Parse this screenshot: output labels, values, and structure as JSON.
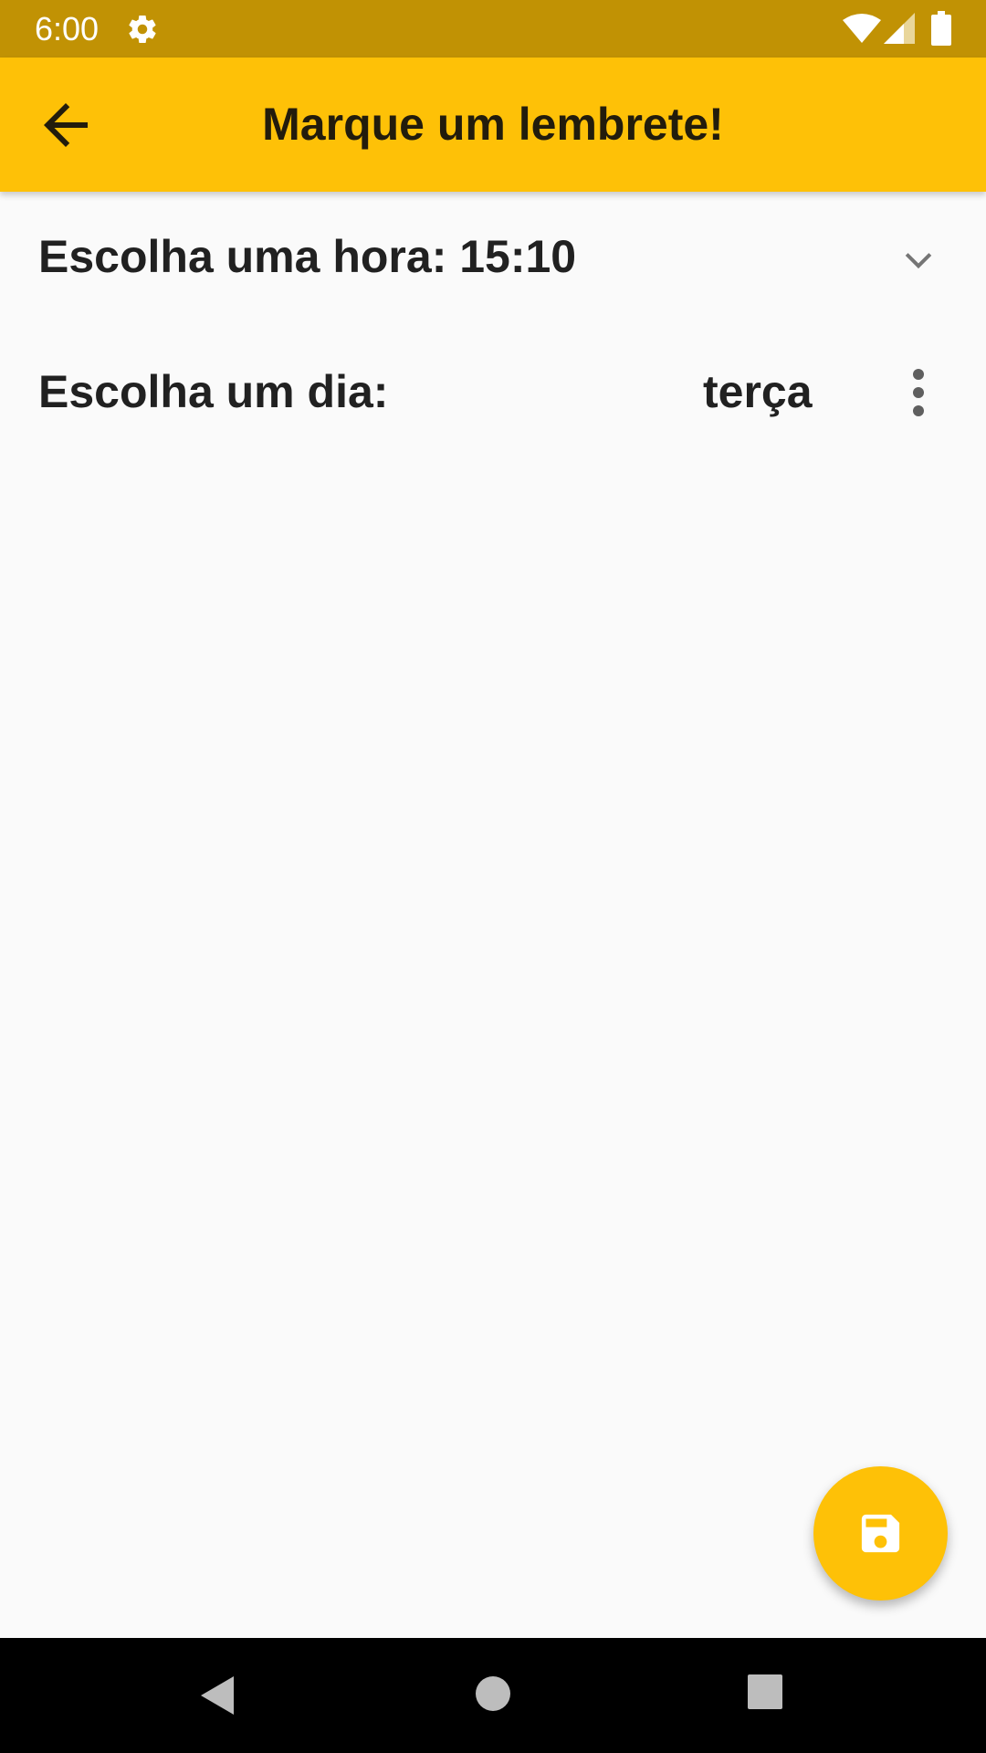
{
  "status_bar": {
    "time": "6:00",
    "color": "#c19204",
    "icons": [
      "gear-icon",
      "wifi-icon",
      "signal-icon",
      "battery-icon"
    ]
  },
  "app_bar": {
    "title": "Marque um lembrete!",
    "back_icon": "arrow-back-icon",
    "color": "#fec107"
  },
  "time_row": {
    "label": "Escolha uma hora: 15:10",
    "icon": "chevron-down-icon"
  },
  "day_row": {
    "label": "Escolha um dia:",
    "value": "terça",
    "icon": "more-vert-icon"
  },
  "fab": {
    "icon": "save-icon",
    "color": "#fec107"
  },
  "nav_bar": {
    "icons": [
      "nav-back-icon",
      "nav-home-icon",
      "nav-recents-icon"
    ]
  }
}
